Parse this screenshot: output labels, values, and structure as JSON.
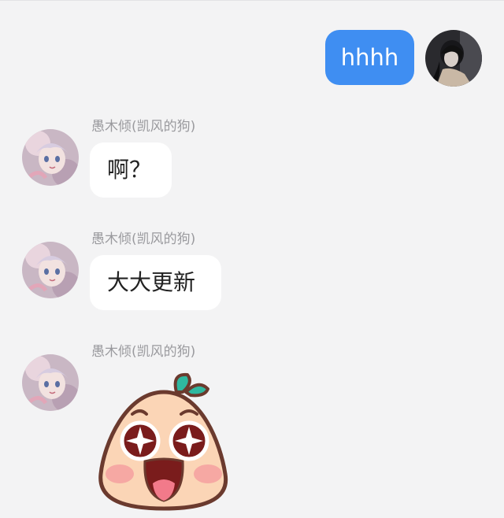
{
  "messages": [
    {
      "side": "self",
      "text": "hhhh",
      "avatar_icon": "self-avatar"
    },
    {
      "side": "other",
      "sender": "愚木倾(凯风的狗)",
      "text": "啊？",
      "avatar_icon": "anime-girl-avatar"
    },
    {
      "side": "other",
      "sender": "愚木倾(凯风的狗)",
      "text": "大大更新",
      "avatar_icon": "anime-girl-avatar"
    },
    {
      "side": "other",
      "sender": "愚木倾(凯风的狗)",
      "sticker": "starry-eyed-peach-sticker",
      "avatar_icon": "anime-girl-avatar"
    }
  ],
  "colors": {
    "background": "#f3f3f4",
    "self_bubble": "#3f8ef2",
    "other_bubble": "#ffffff",
    "sender_name": "#9a9a9e"
  }
}
